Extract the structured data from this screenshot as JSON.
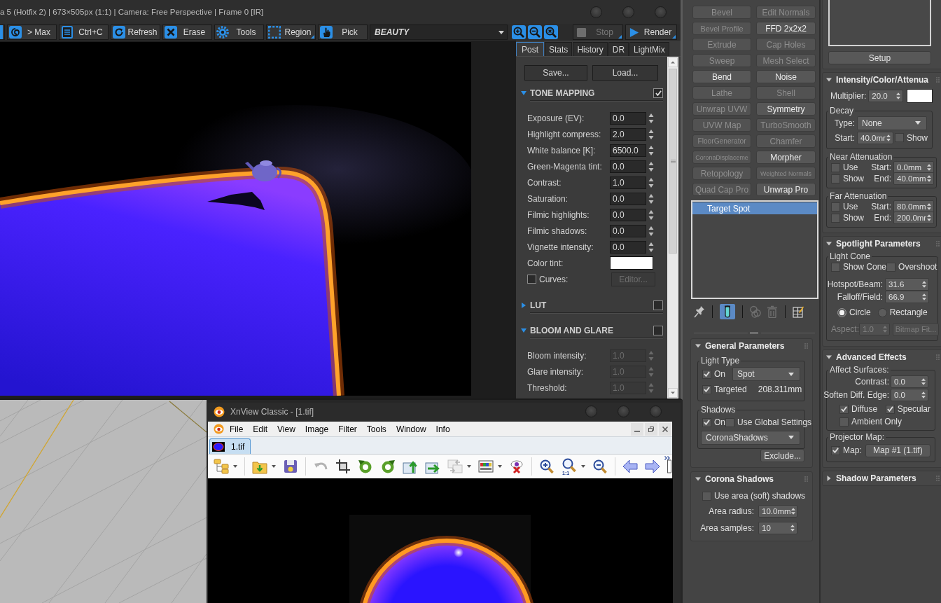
{
  "vfb": {
    "title": "a 5 (Hotfix 2) | 673×505px (1:1) | Camera: Free Perspective | Frame 0 [IR]",
    "toolbar": [
      {
        "kind": "max",
        "label": "> Max",
        "options": false
      },
      {
        "kind": "copy",
        "label": "Ctrl+C",
        "options": false
      },
      {
        "kind": "refresh",
        "label": "Refresh",
        "options": false
      },
      {
        "kind": "erase",
        "label": "Erase",
        "options": false
      },
      {
        "kind": "tools",
        "label": "Tools",
        "options": false
      },
      {
        "kind": "region",
        "label": "Region",
        "options": true
      },
      {
        "kind": "pick",
        "label": "Pick",
        "options": false
      }
    ],
    "channel": "BEAUTY",
    "actions": [
      {
        "kind": "stop",
        "label": "Stop",
        "disabled": true,
        "options": true
      },
      {
        "kind": "render",
        "label": "Render",
        "disabled": false,
        "options": true
      }
    ],
    "tabs": [
      {
        "label": "Post",
        "selected": true
      },
      {
        "label": "Stats",
        "selected": false
      },
      {
        "label": "History",
        "selected": false
      },
      {
        "label": "DR",
        "selected": false
      },
      {
        "label": "LightMix",
        "selected": false
      }
    ],
    "buttons": [
      "Save...",
      "Load..."
    ],
    "sections": [
      {
        "title": "TONE MAPPING",
        "expanded": true,
        "checked": true,
        "rows": [
          {
            "kind": "spinner",
            "label": "Exposure (EV):",
            "value": "0.0",
            "disabled": false
          },
          {
            "kind": "spinner",
            "label": "Highlight compress:",
            "value": "2.0",
            "disabled": false
          },
          {
            "kind": "spinner",
            "label": "White balance [K]:",
            "value": "6500.0",
            "disabled": false
          },
          {
            "kind": "spinner",
            "label": "Green-Magenta tint:",
            "value": "0.0",
            "disabled": false
          },
          {
            "kind": "spinner",
            "label": "Contrast:",
            "value": "1.0",
            "disabled": false
          },
          {
            "kind": "spinner",
            "label": "Saturation:",
            "value": "0.0",
            "disabled": false
          },
          {
            "kind": "spinner",
            "label": "Filmic highlights:",
            "value": "0.0",
            "disabled": false
          },
          {
            "kind": "spinner",
            "label": "Filmic shadows:",
            "value": "0.0",
            "disabled": false
          },
          {
            "kind": "spinner",
            "label": "Vignette intensity:",
            "value": "0.0",
            "disabled": false
          },
          {
            "kind": "color",
            "label": "Color tint:",
            "color": "#ffffff"
          },
          {
            "kind": "check",
            "label": "Curves:",
            "checked": false,
            "button": "Editor...",
            "disabled": true
          }
        ]
      },
      {
        "title": "LUT",
        "expanded": false,
        "checked": false
      },
      {
        "title": "BLOOM AND GLARE",
        "expanded": true,
        "checked": false,
        "rows": [
          {
            "kind": "spinner",
            "label": "Bloom intensity:",
            "value": "1.0",
            "disabled": true
          },
          {
            "kind": "spinner",
            "label": "Glare intensity:",
            "value": "1.0",
            "disabled": true
          },
          {
            "kind": "spinner",
            "label": "Threshold:",
            "value": "1.0",
            "disabled": true
          }
        ]
      }
    ]
  },
  "xnview": {
    "title": "XnView Classic - [1.tif]",
    "menu": [
      "File",
      "Edit",
      "View",
      "Image",
      "Filter",
      "Tools",
      "Window",
      "Info"
    ],
    "tabs": [
      {
        "label": "1.tif",
        "selected": true
      }
    ],
    "toolbar": [
      [
        {
          "kind": "folders",
          "disabled": false,
          "menu": true
        }
      ],
      [
        {
          "kind": "open",
          "disabled": false,
          "menu": true
        },
        {
          "kind": "save",
          "disabled": false,
          "menu": false
        }
      ],
      [
        {
          "kind": "undo",
          "disabled": true,
          "menu": false
        },
        {
          "kind": "crop",
          "disabled": false,
          "menu": false
        },
        {
          "kind": "rotate-left",
          "disabled": false,
          "menu": false
        },
        {
          "kind": "rotate-right",
          "disabled": false,
          "menu": false
        },
        {
          "kind": "export",
          "disabled": false,
          "menu": false
        },
        {
          "kind": "share",
          "disabled": false,
          "menu": false
        },
        {
          "kind": "compare",
          "disabled": true,
          "menu": true
        },
        {
          "kind": "adjust",
          "disabled": false,
          "menu": true
        },
        {
          "kind": "redeye",
          "disabled": false,
          "menu": false
        }
      ],
      [
        {
          "kind": "zoom-in",
          "disabled": false,
          "menu": false
        },
        {
          "kind": "zoom-actual",
          "label": "1:1",
          "disabled": false,
          "menu": true
        },
        {
          "kind": "zoom-out",
          "disabled": false,
          "menu": false
        }
      ],
      [
        {
          "kind": "back",
          "disabled": false,
          "menu": false
        },
        {
          "kind": "forward",
          "disabled": false,
          "menu": false
        },
        {
          "kind": "cut",
          "disabled": false,
          "menu": false
        }
      ]
    ]
  },
  "modifiers": {
    "buttons": [
      {
        "label": "Bevel",
        "disabled": true
      },
      {
        "label": "Edit Normals",
        "disabled": true
      },
      {
        "label": "Bevel Profile",
        "disabled": true
      },
      {
        "label": "FFD 2x2x2",
        "disabled": false
      },
      {
        "label": "Extrude",
        "disabled": true
      },
      {
        "label": "Cap Holes",
        "disabled": true
      },
      {
        "label": "Sweep",
        "disabled": true
      },
      {
        "label": "Mesh Select",
        "disabled": true
      },
      {
        "label": "Bend",
        "disabled": false
      },
      {
        "label": "Noise",
        "disabled": false
      },
      {
        "label": "Lathe",
        "disabled": true
      },
      {
        "label": "Shell",
        "disabled": true
      },
      {
        "label": "Unwrap UVW",
        "disabled": true
      },
      {
        "label": "Symmetry",
        "disabled": false
      },
      {
        "label": "UVW Map",
        "disabled": true
      },
      {
        "label": "TurboSmooth",
        "disabled": true
      },
      {
        "label": "FloorGenerator",
        "disabled": true
      },
      {
        "label": "Chamfer",
        "disabled": true
      },
      {
        "label": "CoronaDisplaceme",
        "disabled": true
      },
      {
        "label": "Morpher",
        "disabled": false
      },
      {
        "label": "Retopology",
        "disabled": true
      },
      {
        "label": "Weighted Normals",
        "disabled": true
      },
      {
        "label": "Quad Cap Pro",
        "disabled": true
      },
      {
        "label": "Unwrap Pro",
        "disabled": false
      }
    ],
    "stack": [
      {
        "label": "Target Spot",
        "selected": true
      }
    ],
    "tools": [
      [
        {
          "kind": "pin",
          "on": false,
          "disabled": false
        }
      ],
      [
        {
          "kind": "end-result",
          "on": true,
          "disabled": false
        }
      ],
      [
        {
          "kind": "make-unique",
          "on": false,
          "disabled": true
        },
        {
          "kind": "remove",
          "on": false,
          "disabled": true
        }
      ],
      [
        {
          "kind": "configure",
          "on": false,
          "disabled": false
        }
      ]
    ]
  },
  "general_parameters": {
    "title": "General Parameters",
    "expanded": true,
    "light_type": {
      "title": "Light Type",
      "on": {
        "label": "On",
        "checked": true
      },
      "type": "Spot",
      "targeted": {
        "label": "Targeted",
        "checked": true
      },
      "distance": "208.311mm"
    },
    "shadows": {
      "title": "Shadows",
      "on": {
        "label": "On",
        "checked": true
      },
      "global": {
        "label": "Use Global Settings",
        "checked": false
      },
      "type": "CoronaShadows"
    },
    "exclude": "Exclude..."
  },
  "corona_shadows": {
    "title": "Corona Shadows",
    "expanded": true,
    "area": {
      "label": "Use area (soft) shadows",
      "checked": false
    },
    "fields": [
      {
        "label": "Area radius:",
        "value": "10.0mm"
      },
      {
        "label": "Area samples:",
        "value": "10"
      }
    ]
  },
  "preview": {
    "button": "Setup"
  },
  "intensity": {
    "title": "Intensity/Color/Attenua",
    "expanded": true,
    "multiplier": {
      "label": "Multiplier:",
      "value": "20.0"
    },
    "color": "#ffffff",
    "decay": {
      "title": "Decay",
      "type_label": "Type:",
      "type": "None",
      "start_label": "Start:",
      "start": "40.0mr",
      "show": {
        "label": "Show",
        "checked": false
      }
    },
    "attenuation": [
      {
        "title": "Near Attenuation",
        "use": {
          "label": "Use",
          "checked": false
        },
        "show": {
          "label": "Show",
          "checked": false
        },
        "start_label": "Start:",
        "start": "0.0mm",
        "end_label": "End:",
        "end": "40.0mm"
      },
      {
        "title": "Far Attenuation",
        "use": {
          "label": "Use",
          "checked": false
        },
        "show": {
          "label": "Show",
          "checked": false
        },
        "start_label": "Start:",
        "start": "80.0mm",
        "end_label": "End:",
        "end": "200.0mr"
      }
    ]
  },
  "spotlight": {
    "title": "Spotlight Parameters",
    "expanded": true,
    "cone": {
      "title": "Light Cone",
      "show_cone": {
        "label": "Show Cone",
        "checked": false
      },
      "overshoot": {
        "label": "Overshoot",
        "checked": false
      },
      "hotspot": {
        "label": "Hotspot/Beam:",
        "value": "31.6"
      },
      "falloff": {
        "label": "Falloff/Field:",
        "value": "66.9"
      },
      "shapes": [
        {
          "label": "Circle",
          "selected": true
        },
        {
          "label": "Rectangle",
          "selected": false
        }
      ],
      "aspect": {
        "label": "Aspect:",
        "value": "1.0",
        "disabled": true
      },
      "bitmap_fit": {
        "label": "Bitmap Fit...",
        "disabled": true
      }
    }
  },
  "advanced_effects": {
    "title": "Advanced Effects",
    "expanded": true,
    "surfaces": {
      "title": "Affect Surfaces:",
      "contrast": {
        "label": "Contrast:",
        "value": "0.0"
      },
      "soften": {
        "label": "Soften Diff. Edge:",
        "value": "0.0"
      },
      "diffuse": {
        "label": "Diffuse",
        "checked": true
      },
      "specular": {
        "label": "Specular",
        "checked": true
      },
      "ambient": {
        "label": "Ambient Only",
        "checked": false
      }
    },
    "projector": {
      "title": "Projector Map:",
      "map": {
        "label": "Map:",
        "checked": true
      },
      "button": "Map #1 (1.tif)"
    }
  },
  "shadow_parameters": {
    "title": "Shadow Parameters",
    "expanded": false
  }
}
